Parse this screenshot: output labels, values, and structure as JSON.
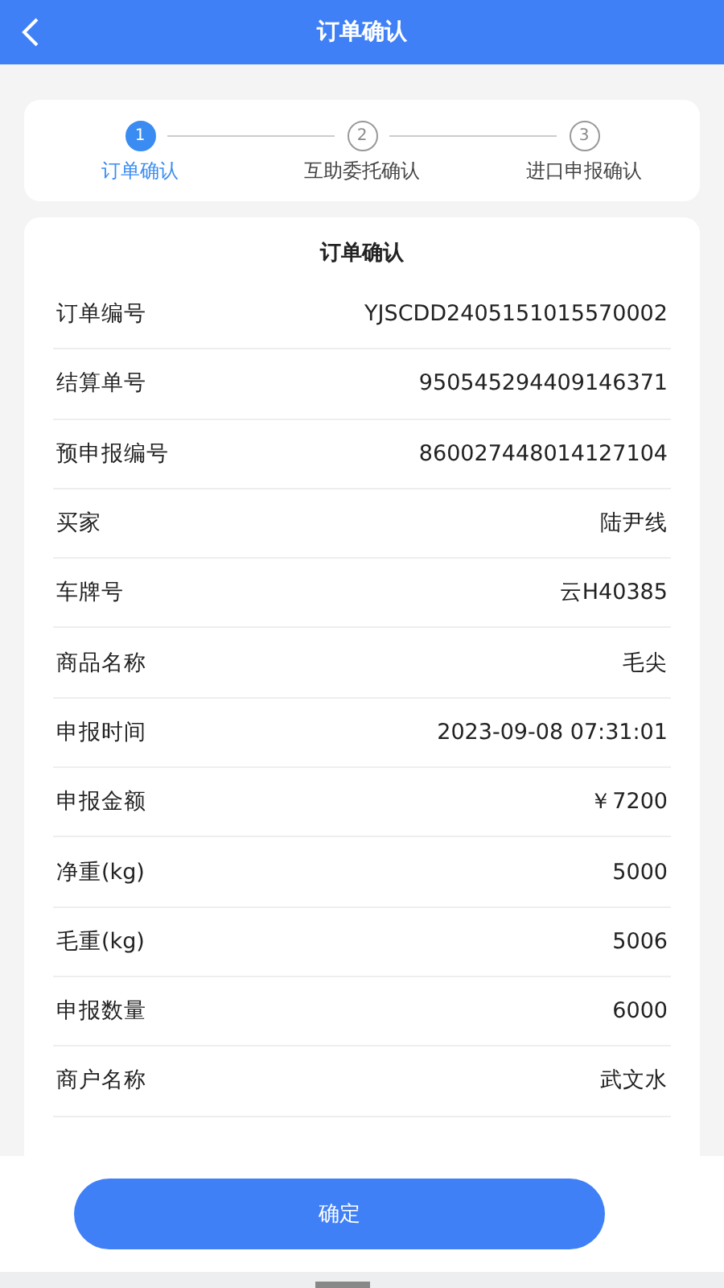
{
  "header": {
    "title": "订单确认"
  },
  "steps": [
    {
      "number": "1",
      "label": "订单确认",
      "selected": true
    },
    {
      "number": "2",
      "label": "互助委托确认",
      "selected": false
    },
    {
      "number": "3",
      "label": "进口申报确认",
      "selected": false
    }
  ],
  "card": {
    "title": "订单确认",
    "rows": [
      {
        "label": "订单编号",
        "value": "YJSCDD2405151015570002"
      },
      {
        "label": "结算单号",
        "value": "950545294409146371"
      },
      {
        "label": "预申报编号",
        "value": "860027448014127104"
      },
      {
        "label": "买家",
        "value": "陆尹线"
      },
      {
        "label": "车牌号",
        "value": "云H40385"
      },
      {
        "label": "商品名称",
        "value": "毛尖"
      },
      {
        "label": "申报时间",
        "value": "2023-09-08 07:31:01"
      },
      {
        "label": "申报金额",
        "value": "￥7200"
      },
      {
        "label": "净重(kg)",
        "value": "5000"
      },
      {
        "label": "毛重(kg)",
        "value": "5006"
      },
      {
        "label": "申报数量",
        "value": "6000"
      },
      {
        "label": "商户名称",
        "value": "武文水"
      }
    ]
  },
  "confirm_button": "确定"
}
